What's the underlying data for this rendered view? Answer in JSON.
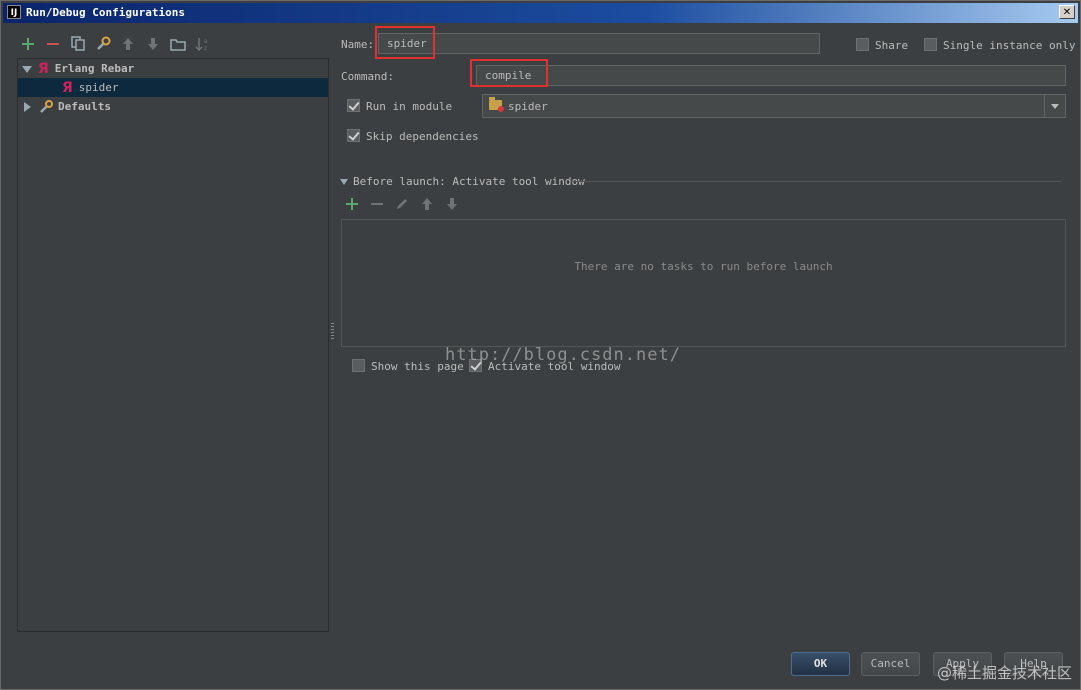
{
  "window": {
    "title": "Run/Debug Configurations",
    "icon_text": "IJ"
  },
  "toolbar": {
    "icons": [
      "add-icon",
      "remove-icon",
      "copy-icon",
      "wrench-icon",
      "move-up-icon",
      "move-down-icon",
      "folder-icon",
      "sort-icon"
    ]
  },
  "tree": {
    "items": [
      {
        "label": "Erlang Rebar",
        "expanded": true
      },
      {
        "label": "spider",
        "selected": true
      },
      {
        "label": "Defaults",
        "expanded": false
      }
    ]
  },
  "form": {
    "name_label": "Name:",
    "name_value": "spider",
    "share_label": "Share",
    "single_instance_label": "Single instance only",
    "command_label": "Command:",
    "command_value": "compile",
    "run_in_module_label": "Run in module",
    "module_value": "spider",
    "skip_deps_label": "Skip dependencies"
  },
  "before_launch": {
    "title": "Before launch: Activate tool window",
    "empty_text": "There are no tasks to run before launch",
    "show_page_label": "Show this page",
    "activate_tool_window_label": "Activate tool window"
  },
  "watermark": {
    "url": "http://blog.csdn.net/",
    "site": "@稀土掘金技术社区"
  },
  "buttons": {
    "ok": "OK",
    "cancel": "Cancel",
    "apply": "Apply",
    "help": "Help"
  },
  "colors": {
    "background": "#3c3f41",
    "selection": "#0d293e",
    "highlight_box": "#e03030",
    "add_green": "#59a869",
    "remove_red": "#c75450",
    "rebar_icon": "#c9245d"
  }
}
